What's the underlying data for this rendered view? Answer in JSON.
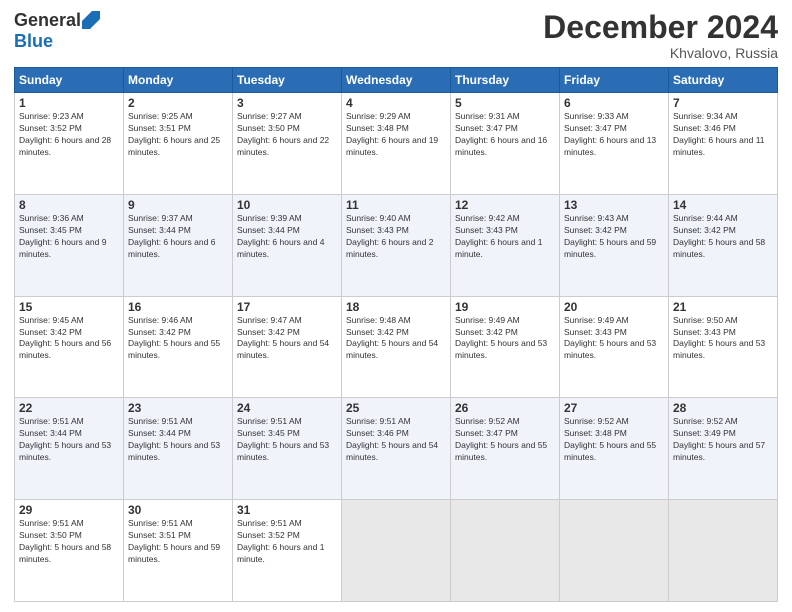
{
  "logo": {
    "general": "General",
    "blue": "Blue"
  },
  "title": "December 2024",
  "location": "Khvalovo, Russia",
  "days_header": [
    "Sunday",
    "Monday",
    "Tuesday",
    "Wednesday",
    "Thursday",
    "Friday",
    "Saturday"
  ],
  "weeks": [
    [
      {
        "num": "1",
        "sunrise": "Sunrise: 9:23 AM",
        "sunset": "Sunset: 3:52 PM",
        "daylight": "Daylight: 6 hours and 28 minutes."
      },
      {
        "num": "2",
        "sunrise": "Sunrise: 9:25 AM",
        "sunset": "Sunset: 3:51 PM",
        "daylight": "Daylight: 6 hours and 25 minutes."
      },
      {
        "num": "3",
        "sunrise": "Sunrise: 9:27 AM",
        "sunset": "Sunset: 3:50 PM",
        "daylight": "Daylight: 6 hours and 22 minutes."
      },
      {
        "num": "4",
        "sunrise": "Sunrise: 9:29 AM",
        "sunset": "Sunset: 3:48 PM",
        "daylight": "Daylight: 6 hours and 19 minutes."
      },
      {
        "num": "5",
        "sunrise": "Sunrise: 9:31 AM",
        "sunset": "Sunset: 3:47 PM",
        "daylight": "Daylight: 6 hours and 16 minutes."
      },
      {
        "num": "6",
        "sunrise": "Sunrise: 9:33 AM",
        "sunset": "Sunset: 3:47 PM",
        "daylight": "Daylight: 6 hours and 13 minutes."
      },
      {
        "num": "7",
        "sunrise": "Sunrise: 9:34 AM",
        "sunset": "Sunset: 3:46 PM",
        "daylight": "Daylight: 6 hours and 11 minutes."
      }
    ],
    [
      {
        "num": "8",
        "sunrise": "Sunrise: 9:36 AM",
        "sunset": "Sunset: 3:45 PM",
        "daylight": "Daylight: 6 hours and 9 minutes."
      },
      {
        "num": "9",
        "sunrise": "Sunrise: 9:37 AM",
        "sunset": "Sunset: 3:44 PM",
        "daylight": "Daylight: 6 hours and 6 minutes."
      },
      {
        "num": "10",
        "sunrise": "Sunrise: 9:39 AM",
        "sunset": "Sunset: 3:44 PM",
        "daylight": "Daylight: 6 hours and 4 minutes."
      },
      {
        "num": "11",
        "sunrise": "Sunrise: 9:40 AM",
        "sunset": "Sunset: 3:43 PM",
        "daylight": "Daylight: 6 hours and 2 minutes."
      },
      {
        "num": "12",
        "sunrise": "Sunrise: 9:42 AM",
        "sunset": "Sunset: 3:43 PM",
        "daylight": "Daylight: 6 hours and 1 minute."
      },
      {
        "num": "13",
        "sunrise": "Sunrise: 9:43 AM",
        "sunset": "Sunset: 3:42 PM",
        "daylight": "Daylight: 5 hours and 59 minutes."
      },
      {
        "num": "14",
        "sunrise": "Sunrise: 9:44 AM",
        "sunset": "Sunset: 3:42 PM",
        "daylight": "Daylight: 5 hours and 58 minutes."
      }
    ],
    [
      {
        "num": "15",
        "sunrise": "Sunrise: 9:45 AM",
        "sunset": "Sunset: 3:42 PM",
        "daylight": "Daylight: 5 hours and 56 minutes."
      },
      {
        "num": "16",
        "sunrise": "Sunrise: 9:46 AM",
        "sunset": "Sunset: 3:42 PM",
        "daylight": "Daylight: 5 hours and 55 minutes."
      },
      {
        "num": "17",
        "sunrise": "Sunrise: 9:47 AM",
        "sunset": "Sunset: 3:42 PM",
        "daylight": "Daylight: 5 hours and 54 minutes."
      },
      {
        "num": "18",
        "sunrise": "Sunrise: 9:48 AM",
        "sunset": "Sunset: 3:42 PM",
        "daylight": "Daylight: 5 hours and 54 minutes."
      },
      {
        "num": "19",
        "sunrise": "Sunrise: 9:49 AM",
        "sunset": "Sunset: 3:42 PM",
        "daylight": "Daylight: 5 hours and 53 minutes."
      },
      {
        "num": "20",
        "sunrise": "Sunrise: 9:49 AM",
        "sunset": "Sunset: 3:43 PM",
        "daylight": "Daylight: 5 hours and 53 minutes."
      },
      {
        "num": "21",
        "sunrise": "Sunrise: 9:50 AM",
        "sunset": "Sunset: 3:43 PM",
        "daylight": "Daylight: 5 hours and 53 minutes."
      }
    ],
    [
      {
        "num": "22",
        "sunrise": "Sunrise: 9:51 AM",
        "sunset": "Sunset: 3:44 PM",
        "daylight": "Daylight: 5 hours and 53 minutes."
      },
      {
        "num": "23",
        "sunrise": "Sunrise: 9:51 AM",
        "sunset": "Sunset: 3:44 PM",
        "daylight": "Daylight: 5 hours and 53 minutes."
      },
      {
        "num": "24",
        "sunrise": "Sunrise: 9:51 AM",
        "sunset": "Sunset: 3:45 PM",
        "daylight": "Daylight: 5 hours and 53 minutes."
      },
      {
        "num": "25",
        "sunrise": "Sunrise: 9:51 AM",
        "sunset": "Sunset: 3:46 PM",
        "daylight": "Daylight: 5 hours and 54 minutes."
      },
      {
        "num": "26",
        "sunrise": "Sunrise: 9:52 AM",
        "sunset": "Sunset: 3:47 PM",
        "daylight": "Daylight: 5 hours and 55 minutes."
      },
      {
        "num": "27",
        "sunrise": "Sunrise: 9:52 AM",
        "sunset": "Sunset: 3:48 PM",
        "daylight": "Daylight: 5 hours and 55 minutes."
      },
      {
        "num": "28",
        "sunrise": "Sunrise: 9:52 AM",
        "sunset": "Sunset: 3:49 PM",
        "daylight": "Daylight: 5 hours and 57 minutes."
      }
    ],
    [
      {
        "num": "29",
        "sunrise": "Sunrise: 9:51 AM",
        "sunset": "Sunset: 3:50 PM",
        "daylight": "Daylight: 5 hours and 58 minutes."
      },
      {
        "num": "30",
        "sunrise": "Sunrise: 9:51 AM",
        "sunset": "Sunset: 3:51 PM",
        "daylight": "Daylight: 5 hours and 59 minutes."
      },
      {
        "num": "31",
        "sunrise": "Sunrise: 9:51 AM",
        "sunset": "Sunset: 3:52 PM",
        "daylight": "Daylight: 6 hours and 1 minute."
      },
      {
        "num": "",
        "sunrise": "",
        "sunset": "",
        "daylight": ""
      },
      {
        "num": "",
        "sunrise": "",
        "sunset": "",
        "daylight": ""
      },
      {
        "num": "",
        "sunrise": "",
        "sunset": "",
        "daylight": ""
      },
      {
        "num": "",
        "sunrise": "",
        "sunset": "",
        "daylight": ""
      }
    ]
  ]
}
